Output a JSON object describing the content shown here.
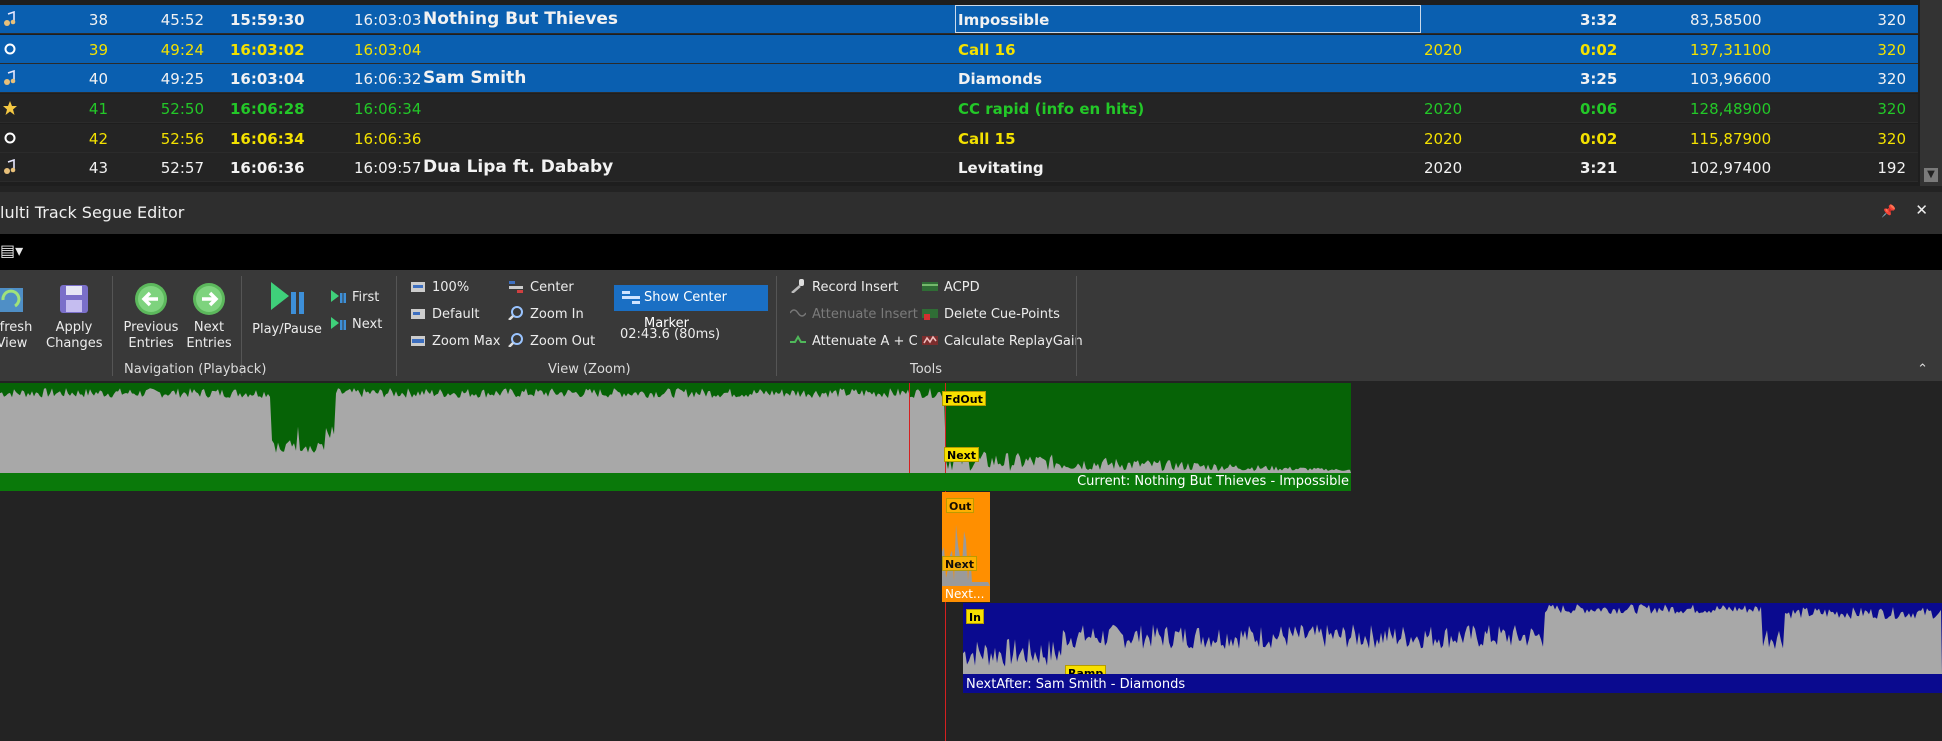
{
  "playlist": {
    "rows": [
      {
        "num": "38",
        "t1": "45:52",
        "t2": "15:59:30",
        "t3": "16:03:03",
        "artist": "Nothing But Thieves",
        "title": "Impossible",
        "year": "",
        "dur": "3:32",
        "bpm": "83,58500",
        "kbps": "320",
        "style": "sel",
        "icon": "music-note-icon"
      },
      {
        "num": "39",
        "t1": "49:24",
        "t2": "16:03:02",
        "t3": "16:03:04",
        "artist": "",
        "title": "Call 16",
        "year": "2020",
        "dur": "0:02",
        "bpm": "137,31100",
        "kbps": "320",
        "style": "sel yellow",
        "icon": "ring-icon"
      },
      {
        "num": "40",
        "t1": "49:25",
        "t2": "16:03:04",
        "t3": "16:06:32",
        "artist": "Sam Smith",
        "title": "Diamonds",
        "year": "",
        "dur": "3:25",
        "bpm": "103,96600",
        "kbps": "320",
        "style": "sel",
        "icon": "music-note-icon"
      },
      {
        "num": "41",
        "t1": "52:50",
        "t2": "16:06:28",
        "t3": "16:06:34",
        "artist": "",
        "title": "CC rapid (info en hits)",
        "year": "2020",
        "dur": "0:06",
        "bpm": "128,48900",
        "kbps": "320",
        "style": "dark green",
        "icon": "star-icon"
      },
      {
        "num": "42",
        "t1": "52:56",
        "t2": "16:06:34",
        "t3": "16:06:36",
        "artist": "",
        "title": "Call 15",
        "year": "2020",
        "dur": "0:02",
        "bpm": "115,87900",
        "kbps": "320",
        "style": "dark yellow",
        "icon": "ring-icon"
      },
      {
        "num": "43",
        "t1": "52:57",
        "t2": "16:06:36",
        "t3": "16:09:57",
        "artist": "Dua Lipa ft. Dababy",
        "title": "Levitating",
        "year": "2020",
        "dur": "3:21",
        "bpm": "102,97400",
        "kbps": "192",
        "style": "dark",
        "icon": "music-note-icon"
      }
    ]
  },
  "editor": {
    "title": "lulti Track Segue Editor",
    "pin": "📌",
    "close": "✕",
    "menu_icon": "▤▾"
  },
  "ribbon": {
    "refresh": "efresh\nView",
    "refresh_1": "efresh",
    "refresh_2": "View",
    "apply_1": "Apply",
    "apply_2": "Changes",
    "prev_1": "Previous",
    "prev_2": "Entries",
    "next_1": "Next",
    "next_2": "Entries",
    "playpause": "Play/Pause",
    "first": "First",
    "next": "Next",
    "zoom100": "100%",
    "default": "Default",
    "zoommax": "Zoom Max",
    "center": "Center",
    "zoomin": "Zoom In",
    "zoomout": "Zoom Out",
    "show_center_marker": "Show Center Marker",
    "position": "02:43.6 (80ms)",
    "record_insert": "Record Insert",
    "attenuate_insert": "Attenuate Insert",
    "attenuate_ac": "Attenuate A + C",
    "acpd": "ACPD",
    "delete_cue": "Delete Cue-Points",
    "calc_replaygain": "Calculate ReplayGain",
    "group_nav": "Navigation (Playback)",
    "group_view": "View (Zoom)",
    "group_tools": "Tools",
    "collapse": "⌃"
  },
  "tracks": {
    "current_label": "Current: Nothing But Thieves - Impossible",
    "next_label": "Next...",
    "nextafter_label": "NextAfter: Sam Smith - Diamonds",
    "markers": {
      "fdout": "FdOut",
      "next": "Next",
      "out": "Out",
      "next2": "Next",
      "in": "In",
      "ramp": "Ramp"
    }
  },
  "colors": {
    "selected_row": "#0a5fb0",
    "current_track": "#066306",
    "next_track": "#ff8f00",
    "nextafter_track": "#0a0a8f",
    "marker": "#f7e000"
  }
}
